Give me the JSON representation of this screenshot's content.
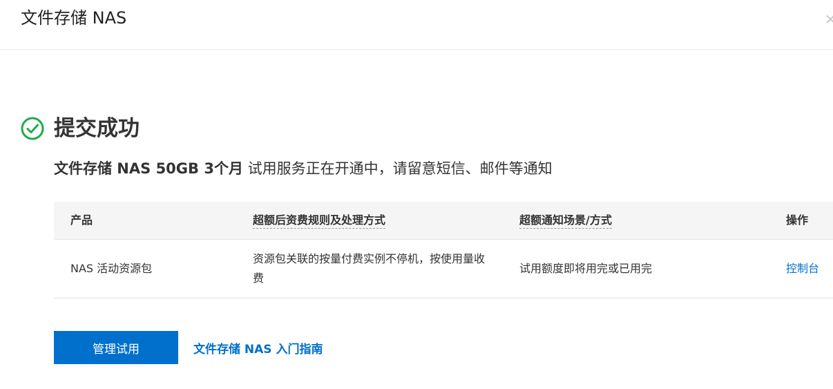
{
  "header": {
    "title": "文件存储 NAS",
    "close_glyph": "✕"
  },
  "success": {
    "icon": "check-circle-icon",
    "icon_color": "#1cac48",
    "title": "提交成功"
  },
  "subtitle": {
    "product": "文件存储 NAS 50GB 3个月",
    "message": " 试用服务正在开通中，请留意短信、邮件等通知"
  },
  "table": {
    "headers": [
      "产品",
      "超额后资费规则及处理方式",
      "超额通知场景/方式",
      "操作"
    ],
    "rows": [
      {
        "product": "NAS 活动资源包",
        "billing_rule": "资源包关联的按量付费实例不停机，按使用量收费",
        "notice": "试用额度即将用完或已用完",
        "action": "控制台"
      }
    ]
  },
  "actions": {
    "manage_label": "管理试用",
    "guide_label": "文件存储 NAS 入门指南"
  },
  "colors": {
    "primary": "#0070cc",
    "success": "#1cac48"
  }
}
